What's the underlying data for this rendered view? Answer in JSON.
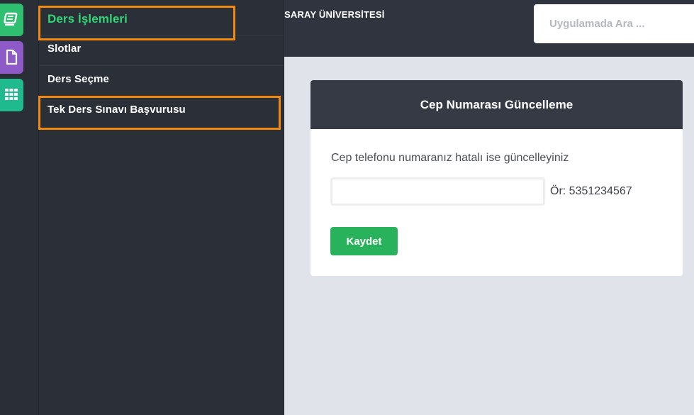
{
  "icons": {
    "rail": [
      "book-icon",
      "document-icon",
      "grid-icon"
    ]
  },
  "menu": {
    "items": [
      {
        "label": "Ders İşlemleri",
        "active": true
      },
      {
        "label": "Slotlar"
      },
      {
        "label": "Ders Seçme"
      },
      {
        "label": "Tek Ders Sınavı Başvurusu"
      }
    ]
  },
  "header": {
    "university": "SARAY ÜNİVERSİTESİ",
    "search_placeholder": "Uygulamada Ara ..."
  },
  "card": {
    "title": "Cep Numarası Güncelleme",
    "description": "Cep telefonu numaranız hatalı ise güncelleyiniz",
    "phone_value": "",
    "example": "Ör: 5351234567",
    "save_label": "Kaydet"
  },
  "colors": {
    "accent_green": "#2ed573",
    "button_green": "#28b25b",
    "highlight_orange": "#f0890e",
    "rail_green": "#2fbf71",
    "rail_purple": "#8e5ac7",
    "rail_teal": "#1fba8e"
  }
}
